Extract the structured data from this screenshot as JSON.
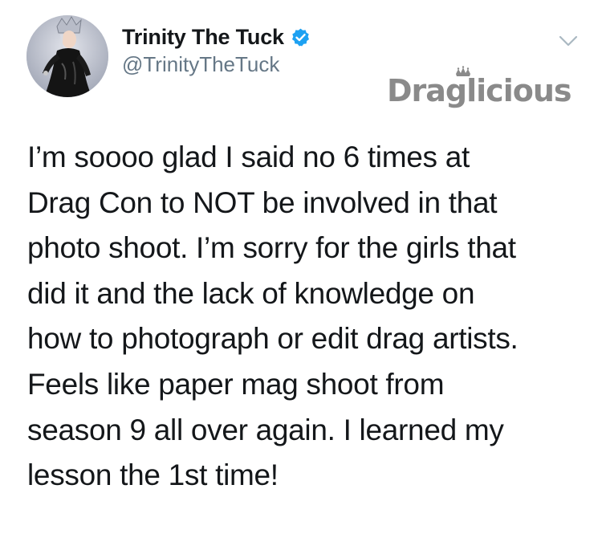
{
  "user": {
    "display_name": "Trinity The Tuck",
    "handle": "@TrinityTheTuck",
    "verified": true,
    "verified_icon": "verified-badge-icon",
    "avatar_icon": "profile-photo"
  },
  "menu": {
    "icon": "chevron-down-icon"
  },
  "watermark": {
    "text": "Draglicious",
    "icon": "draglicious-logo-watermark"
  },
  "tweet": {
    "lines": [
      "I’m soooo glad I said no 6 times at",
      "Drag Con to NOT be involved in that",
      "photo shoot. I’m sorry for the girls that",
      "did it and the lack of knowledge on",
      "how to photograph or edit drag artists.",
      "Feels like paper mag shoot from",
      "season 9 all over again. I learned my",
      "lesson the 1st time!"
    ]
  },
  "colors": {
    "text": "#14171a",
    "secondary_text": "#657786",
    "verified_blue": "#1da1f2",
    "caret_gray": "#aab8c2",
    "watermark_gray": "#8a8a8a"
  }
}
